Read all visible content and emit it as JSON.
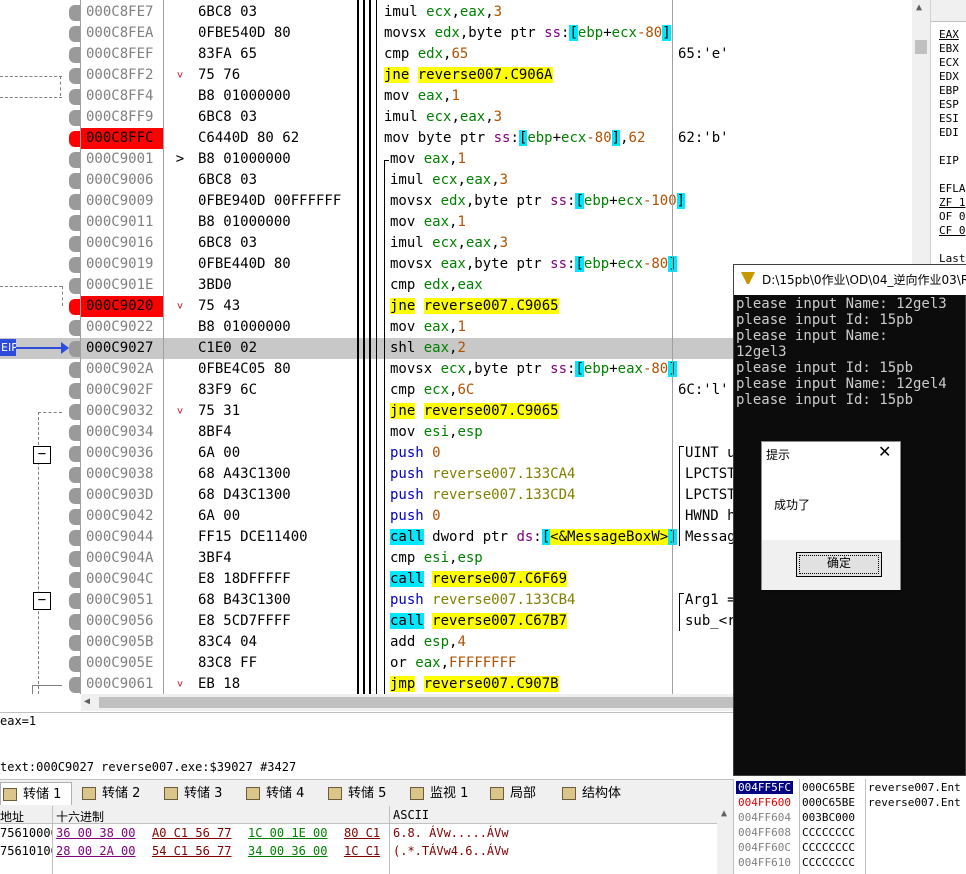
{
  "disasm": {
    "rows": [
      {
        "addr": "000C8FE7",
        "mark": "",
        "bytes": "6BC8 03",
        "inst": "imul ecx,eax,3",
        "cmt": "",
        "bp": false,
        "mn": "none"
      },
      {
        "addr": "000C8FEA",
        "mark": "",
        "bytes": "0FBE540D 80",
        "inst": "movsx edx,byte ptr ss:[ebp+ecx-80]",
        "cmt": "",
        "bp": false,
        "mn": "none"
      },
      {
        "addr": "000C8FEF",
        "mark": "",
        "bytes": "83FA 65",
        "inst": "cmp edx,65",
        "cmt": "65:'e'",
        "bp": false,
        "mn": "none"
      },
      {
        "addr": "000C8FF2",
        "mark": "˅",
        "bytes": "75 76",
        "inst": "jne reverse007.C906A",
        "cmt": "",
        "bp": false,
        "mn": "jne"
      },
      {
        "addr": "000C8FF4",
        "mark": "",
        "bytes": "B8 01000000",
        "inst": "mov eax,1",
        "cmt": "",
        "bp": false,
        "mn": "none"
      },
      {
        "addr": "000C8FF9",
        "mark": "",
        "bytes": "6BC8 03",
        "inst": "imul ecx,eax,3",
        "cmt": "",
        "bp": false,
        "mn": "none"
      },
      {
        "addr": "000C8FFC",
        "mark": "",
        "bytes": "C6440D 80 62",
        "inst": "mov byte ptr ss:[ebp+ecx-80],62",
        "cmt": "62:'b'",
        "bp": true,
        "mn": "none"
      },
      {
        "addr": "000C9001",
        "mark": ">",
        "bytes": "B8 01000000",
        "inst": "mov eax,1",
        "cmt": "",
        "bp": false,
        "mn": "none"
      },
      {
        "addr": "000C9006",
        "mark": "",
        "bytes": "6BC8 03",
        "inst": "imul ecx,eax,3",
        "cmt": "",
        "bp": false,
        "mn": "none"
      },
      {
        "addr": "000C9009",
        "mark": "",
        "bytes": "0FBE940D 00FFFFFF",
        "inst": "movsx edx,byte ptr ss:[ebp+ecx-100]",
        "cmt": "",
        "bp": false,
        "mn": "none"
      },
      {
        "addr": "000C9011",
        "mark": "",
        "bytes": "B8 01000000",
        "inst": "mov eax,1",
        "cmt": "",
        "bp": false,
        "mn": "none"
      },
      {
        "addr": "000C9016",
        "mark": "",
        "bytes": "6BC8 03",
        "inst": "imul ecx,eax,3",
        "cmt": "",
        "bp": false,
        "mn": "none"
      },
      {
        "addr": "000C9019",
        "mark": "",
        "bytes": "0FBE440D 80",
        "inst": "movsx eax,byte ptr ss:[ebp+ecx-80]",
        "cmt": "",
        "bp": false,
        "mn": "none"
      },
      {
        "addr": "000C901E",
        "mark": "",
        "bytes": "3BD0",
        "inst": "cmp edx,eax",
        "cmt": "",
        "bp": false,
        "mn": "none"
      },
      {
        "addr": "000C9020",
        "mark": "˅",
        "bytes": "75 43",
        "inst": "jne reverse007.C9065",
        "cmt": "",
        "bp": true,
        "mn": "jne"
      },
      {
        "addr": "000C9022",
        "mark": "",
        "bytes": "B8 01000000",
        "inst": "mov eax,1",
        "cmt": "",
        "bp": false,
        "mn": "none"
      },
      {
        "addr": "000C9027",
        "mark": "",
        "bytes": "C1E0 02",
        "inst": "shl eax,2",
        "cmt": "",
        "bp": false,
        "mn": "none",
        "cur": true
      },
      {
        "addr": "000C902A",
        "mark": "",
        "bytes": "0FBE4C05 80",
        "inst": "movsx ecx,byte ptr ss:[ebp+eax-80]",
        "cmt": "",
        "bp": false,
        "mn": "none"
      },
      {
        "addr": "000C902F",
        "mark": "",
        "bytes": "83F9 6C",
        "inst": "cmp ecx,6C",
        "cmt": "6C:'l'",
        "bp": false,
        "mn": "none"
      },
      {
        "addr": "000C9032",
        "mark": "˅",
        "bytes": "75 31",
        "inst": "jne reverse007.C9065",
        "cmt": "",
        "bp": false,
        "mn": "jne"
      },
      {
        "addr": "000C9034",
        "mark": "",
        "bytes": "8BF4",
        "inst": "mov esi,esp",
        "cmt": "",
        "bp": false,
        "mn": "none"
      },
      {
        "addr": "000C9036",
        "mark": "",
        "bytes": "6A 00",
        "inst": "push 0",
        "cmt": "UINT u",
        "bp": false,
        "mn": "push"
      },
      {
        "addr": "000C9038",
        "mark": "",
        "bytes": "68 A43C1300",
        "inst": "push reverse007.133CA4",
        "cmt": "LPCTST",
        "bp": false,
        "mn": "push"
      },
      {
        "addr": "000C903D",
        "mark": "",
        "bytes": "68 D43C1300",
        "inst": "push reverse007.133CD4",
        "cmt": "LPCTST",
        "bp": false,
        "mn": "push"
      },
      {
        "addr": "000C9042",
        "mark": "",
        "bytes": "6A 00",
        "inst": "push 0",
        "cmt": "HWND h",
        "bp": false,
        "mn": "push"
      },
      {
        "addr": "000C9044",
        "mark": "",
        "bytes": "FF15 DCE11400",
        "inst": "call dword ptr ds:[<&MessageBoxW>]",
        "cmt": "Messag",
        "bp": false,
        "mn": "call"
      },
      {
        "addr": "000C904A",
        "mark": "",
        "bytes": "3BF4",
        "inst": "cmp esi,esp",
        "cmt": "",
        "bp": false,
        "mn": "none"
      },
      {
        "addr": "000C904C",
        "mark": "",
        "bytes": "E8 18DFFFFF",
        "inst": "call reverse007.C6F69",
        "cmt": "",
        "bp": false,
        "mn": "call"
      },
      {
        "addr": "000C9051",
        "mark": "",
        "bytes": "68 B43C1300",
        "inst": "push reverse007.133CB4",
        "cmt": "Arg1 =",
        "bp": false,
        "mn": "push"
      },
      {
        "addr": "000C9056",
        "mark": "",
        "bytes": "E8 5CD7FFFF",
        "inst": "call reverse007.C67B7",
        "cmt": "sub_<r",
        "bp": false,
        "mn": "call"
      },
      {
        "addr": "000C905B",
        "mark": "",
        "bytes": "83C4 04",
        "inst": "add esp,4",
        "cmt": "",
        "bp": false,
        "mn": "none"
      },
      {
        "addr": "000C905E",
        "mark": "",
        "bytes": "83C8 FF",
        "inst": "or eax,FFFFFFFF",
        "cmt": "",
        "bp": false,
        "mn": "none"
      },
      {
        "addr": "000C9061",
        "mark": "˅",
        "bytes": "EB 18",
        "inst": "jmp reverse007.C907B",
        "cmt": "",
        "bp": false,
        "mn": "jmp"
      }
    ],
    "eip_label": "EIP"
  },
  "registers": {
    "labels": [
      "EAX",
      "EBX",
      "ECX",
      "EDX",
      "EBP",
      "ESP",
      "ESI",
      "EDI",
      "",
      "EIP",
      "",
      "EFLA",
      "ZF 1",
      "OF 0",
      "CF 0",
      "",
      "Last",
      "Last"
    ]
  },
  "info": {
    "expr": "eax=1",
    "location": "text:000C9027 reverse007.exe:$39027 #3427"
  },
  "tabs": [
    {
      "label": "转储 1",
      "selected": true
    },
    {
      "label": "转储 2",
      "selected": false
    },
    {
      "label": "转储 3",
      "selected": false
    },
    {
      "label": "转储 4",
      "selected": false
    },
    {
      "label": "转储 5",
      "selected": false
    },
    {
      "label": "监视 1",
      "selected": false
    },
    {
      "label": "局部",
      "selected": false
    },
    {
      "label": "结构体",
      "selected": false
    }
  ],
  "dump": {
    "headers": {
      "addr": "地址",
      "hex": "十六进制",
      "ascii": "ASCII"
    },
    "rows": [
      {
        "addr": "75610000",
        "hex": [
          "36 00 38 00",
          "A0 C1 56 77",
          "1C 00 1E 00",
          "80 C1"
        ],
        "ascii": "6.8. ÁVw.....ÁVw"
      },
      {
        "addr": "75610100",
        "hex": [
          "28 00 2A 00",
          "54 C1 56 77",
          "34 00 36 00",
          "1C C1"
        ],
        "ascii": "(.*.TÁVw4.6..ÁVw"
      }
    ]
  },
  "stack": {
    "rows": [
      {
        "addr": "004FF5FC",
        "val": "000C65BE",
        "cmt": "reverse007.Ent",
        "sel": true
      },
      {
        "addr": "004FF600",
        "val": "000C65BE",
        "cmt": "reverse007.Ent",
        "sel": false
      },
      {
        "addr": "004FF604",
        "val": "003BC000",
        "cmt": "",
        "sel": false
      },
      {
        "addr": "004FF608",
        "val": "CCCCCCCC",
        "cmt": "",
        "sel": false
      },
      {
        "addr": "004FF60C",
        "val": "CCCCCCCC",
        "cmt": "",
        "sel": false
      },
      {
        "addr": "004FF610",
        "val": "CCCCCCCC",
        "cmt": "",
        "sel": false
      }
    ]
  },
  "console": {
    "title": "D:\\15pb\\0作业\\OD\\04_逆向作业03\\R",
    "lines": [
      "please input Name: 12gel3",
      "please input Id: 15pb",
      "please input Name:",
      "12gel3",
      "please input Id: 15pb",
      "please input Name: 12gel4",
      "please input Id: 15pb"
    ]
  },
  "msgbox": {
    "title": "提示",
    "text": "成功了",
    "ok_label": "确定"
  }
}
